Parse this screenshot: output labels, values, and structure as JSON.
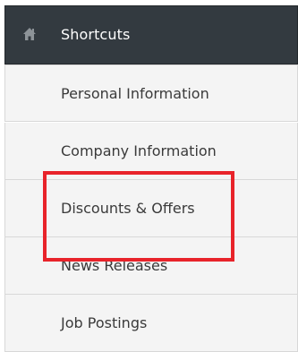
{
  "header": {
    "icon": "home-icon",
    "title": "Shortcuts"
  },
  "menu": {
    "items": [
      {
        "label": "Personal Information"
      },
      {
        "label": "Company Information"
      },
      {
        "label": "Discounts & Offers"
      },
      {
        "label": "News Releases"
      },
      {
        "label": "Job Postings"
      }
    ]
  },
  "annotation": {
    "highlight_color": "#e8232a",
    "highlighted_item": "Discounts & Offers"
  },
  "colors": {
    "header_bg": "#333a40",
    "item_bg": "#f4f4f4",
    "item_text": "#3a3a3a"
  }
}
